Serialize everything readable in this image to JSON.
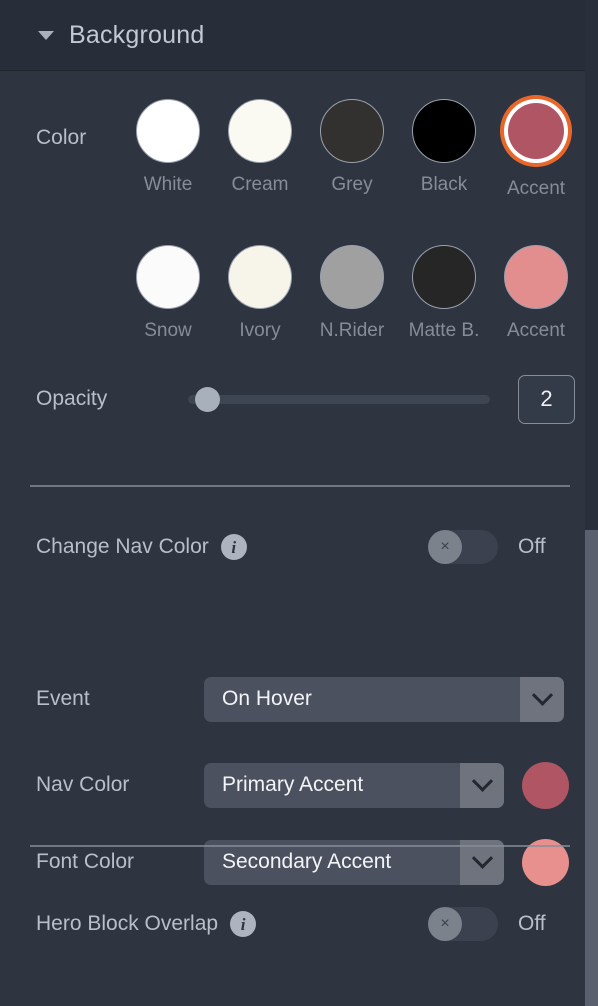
{
  "header": {
    "title": "Background",
    "caret": "triangle-down"
  },
  "color_section": {
    "label": "Color",
    "rows": [
      {
        "swatches": [
          {
            "label": "White",
            "color": "#ffffff",
            "selected": false
          },
          {
            "label": "Cream",
            "color": "#fbfaf2",
            "selected": false
          },
          {
            "label": "Grey",
            "color": "#33312f",
            "selected": false
          },
          {
            "label": "Black",
            "color": "#000000",
            "selected": false
          },
          {
            "label": "Accent",
            "color": "#b05563",
            "selected": true
          }
        ]
      },
      {
        "swatches": [
          {
            "label": "Snow",
            "color": "#fbfbfb",
            "selected": false
          },
          {
            "label": "Ivory",
            "color": "#f7f5ea",
            "selected": false
          },
          {
            "label": "N.Rider",
            "color": "#a0a0a0",
            "selected": false
          },
          {
            "label": "Matte B.",
            "color": "#262626",
            "selected": false
          },
          {
            "label": "Accent",
            "color": "#e28e8e",
            "selected": false
          }
        ]
      }
    ]
  },
  "opacity": {
    "label": "Opacity",
    "value": "2",
    "handle_percent": 1,
    "min": 0,
    "max": 100
  },
  "change_nav_color": {
    "label": "Change Nav Color",
    "info_icon": "info-icon",
    "state": "Off",
    "enabled": false,
    "knob_glyph": "×"
  },
  "event": {
    "label": "Event",
    "value": "On Hover"
  },
  "nav_color": {
    "label": "Nav Color",
    "value": "Primary Accent",
    "preview_color": "#b05563"
  },
  "font_color": {
    "label": "Font Color",
    "value": "Secondary Accent",
    "preview_color": "#e8908d"
  },
  "hero_block_overlap": {
    "label": "Hero Block Overlap",
    "info_icon": "info-icon",
    "state": "Off",
    "enabled": false,
    "knob_glyph": "×"
  },
  "theme": {
    "panel_bg": "#2e3440",
    "header_bg": "#282e39",
    "accent_select_ring": "#e8662a",
    "label_color": "#b8bfcb",
    "swatch_label_color": "#868d99",
    "control_bg": "#4b515e",
    "arrow_bg": "#6e737d",
    "scrollbar_thumb": "#5a606d"
  }
}
